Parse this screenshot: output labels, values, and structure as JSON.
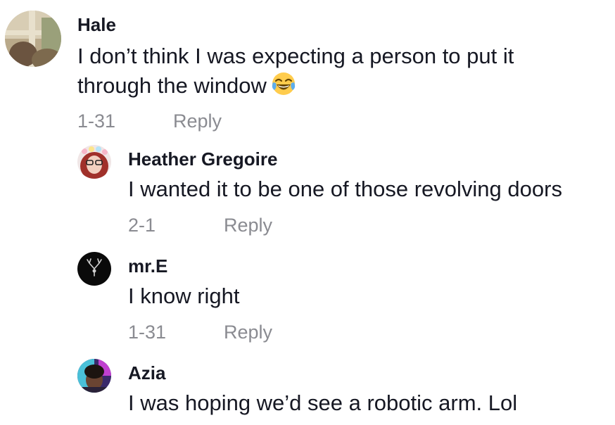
{
  "comments": [
    {
      "username": "Hale",
      "text_line1": "I don’t think I was expecting a person to put it",
      "text_line2": "through the window",
      "emoji": "face-with-tears-of-joy",
      "date": "1-31",
      "reply_label": "Reply"
    },
    {
      "username": "Heather Gregoire",
      "text": "I wanted it to be one of those revolving doors",
      "date": "2-1",
      "reply_label": "Reply"
    },
    {
      "username": "mr.E",
      "text": "I know right",
      "date": "1-31",
      "reply_label": "Reply"
    },
    {
      "username": "Azia",
      "text": "I was hoping we’d see a robotic arm. Lol"
    }
  ]
}
